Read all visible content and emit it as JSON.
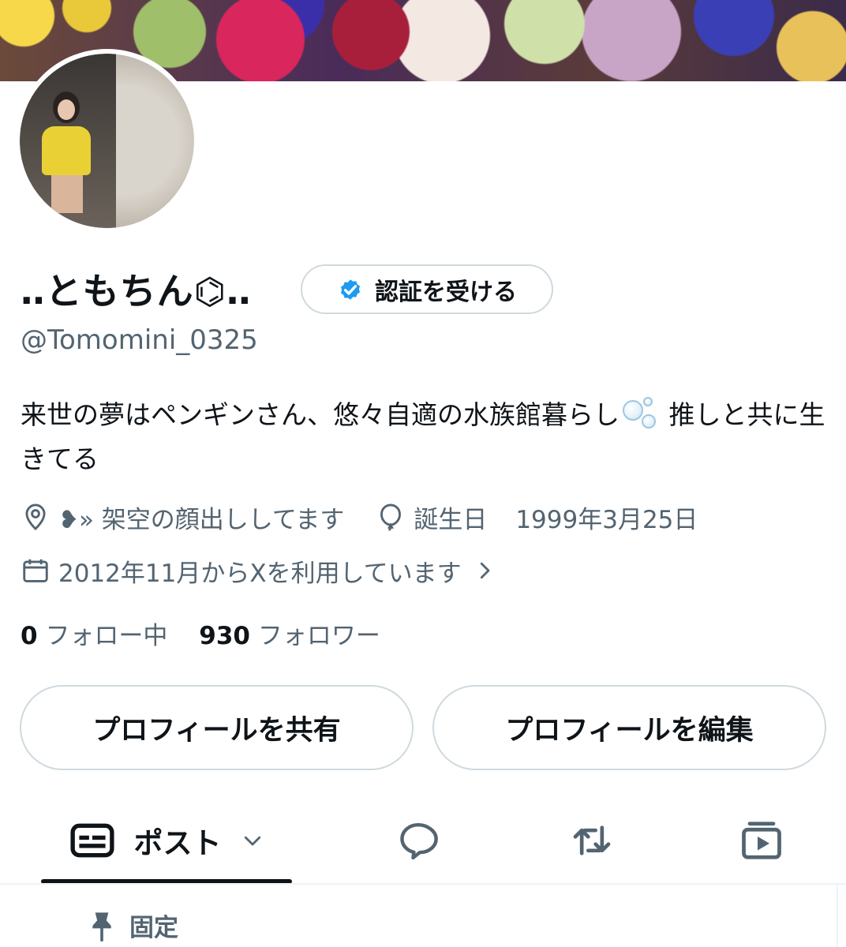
{
  "profile": {
    "display_name": "‥ともちん⌬‥",
    "handle": "@Tomomini_0325",
    "verify_button_label": "認証を受ける",
    "bio_part1": "来世の夢はペンギンさん、悠々自適の水族館暮らし",
    "bio_part2": " 推しと共に生きてる",
    "location": "❥» 架空の顔出ししてます",
    "birthday_label": "誕生日",
    "birthday_value": "1999年3月25日",
    "joined": "2012年11月からXを利用しています",
    "following_count": "0",
    "following_label": "フォロー中",
    "followers_count": "930",
    "followers_label": "フォロワー"
  },
  "actions": {
    "share_label": "プロフィールを共有",
    "edit_label": "プロフィールを編集"
  },
  "tabs": {
    "posts_label": "ポスト"
  },
  "pinned": {
    "label": "固定"
  },
  "icons": [
    "location-icon",
    "balloon-icon",
    "calendar-icon",
    "chevron-right-icon",
    "verified-badge-icon",
    "posts-icon",
    "chevron-down-icon",
    "reply-icon",
    "repost-icon",
    "media-icon",
    "pin-icon"
  ],
  "colors": {
    "text_primary": "#0f1419",
    "text_secondary": "#536471",
    "border": "#cfd9de",
    "verified_blue": "#1d9bf0"
  }
}
